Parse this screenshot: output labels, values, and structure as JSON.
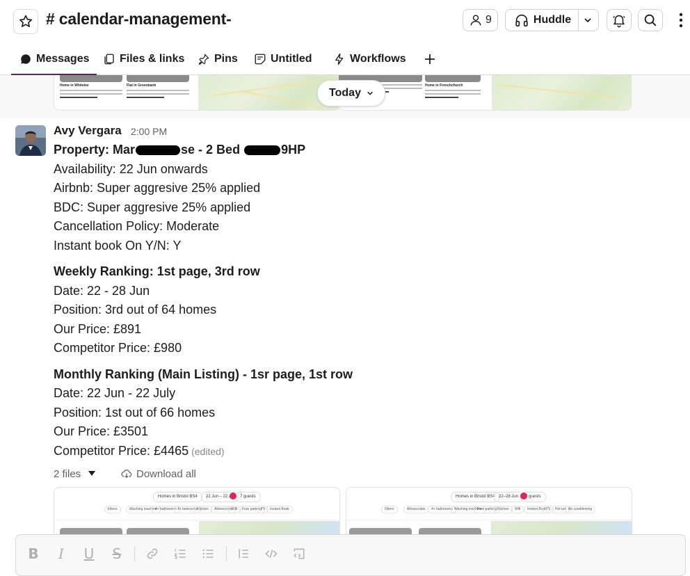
{
  "header": {
    "channel": "# calendar-management-",
    "member_count": "9",
    "huddle_label": "Huddle"
  },
  "tabs": [
    {
      "label": "Messages",
      "icon": "chat-bubble-icon",
      "active": true
    },
    {
      "label": "Files & links",
      "icon": "files-icon"
    },
    {
      "label": "Pins",
      "icon": "pin-icon"
    },
    {
      "label": "Untitled",
      "icon": "canvas-icon"
    },
    {
      "label": "Workflows",
      "icon": "lightning-icon"
    }
  ],
  "divider": {
    "label": "Today"
  },
  "message": {
    "author": "Avy Vergara",
    "time": "2:00 PM",
    "property_prefix": "Property: Mar",
    "property_mid": "se - 2 Bed ",
    "property_suffix": "9HP",
    "lines": [
      "Availability: 22 Jun onwards",
      "Airbnb: Super aggresive 25% applied",
      "BDC: Super aggresive 25% applied",
      "Cancellation Policy: Moderate",
      "Instant book On Y/N: Y"
    ],
    "weekly": {
      "heading": "Weekly Ranking: 1st page, 3rd row",
      "lines": [
        "Date: 22 - 28 Jun",
        "Position: 3rd out of 64 homes",
        "Our Price: £891",
        "Competitor Price: £980"
      ]
    },
    "monthly": {
      "heading": "Monthly Ranking (Main Listing) - 1sr page, 1st row",
      "lines": [
        "Date: 22 Jun - 22 July",
        "Position: 1st out of 66 homes",
        "Our Price: £3501",
        "Competitor Price: £4465"
      ],
      "edited": "(edited)"
    },
    "files": {
      "count_label": "2 files",
      "download_label": "Download all"
    },
    "attachments": [
      {
        "search": "Homes in Bristol BS4",
        "dates": "22 Jun – 22 Jul",
        "guests": "7 guests",
        "filters": [
          "Filters",
          "Washing machine",
          "4+ bathrooms",
          "4+ bedrooms",
          "Kitchen",
          "Allowscripts",
          "Wifi",
          "Free parking",
          "TV",
          "Instant Book"
        ]
      },
      {
        "search": "Homes in Bristol BS4",
        "dates": "22–28 Jun",
        "guests": "7 guests",
        "filters": [
          "Filters",
          "Allowscripts",
          "4+ bathrooms",
          "Washing machine",
          "Free parking",
          "Kitchen",
          "Wifi",
          "Instant Book",
          "TV",
          "Hot tub",
          "Air conditioning"
        ]
      }
    ],
    "strip_cards": [
      {
        "title": "Home in Whitelee",
        "rating": "★ 5.0 (4)"
      },
      {
        "title": "Flat in Greenbank",
        "rating": ""
      },
      {
        "title": "",
        "rating": "★ 5.0 (4)"
      },
      {
        "title": "Home in Frenchchurch",
        "rating": "★ 4.8 (8)"
      }
    ]
  },
  "colors": {
    "accent": "#611f69",
    "text": "#1d1c1d",
    "muted": "#616061",
    "redpin": "#e0245e"
  }
}
